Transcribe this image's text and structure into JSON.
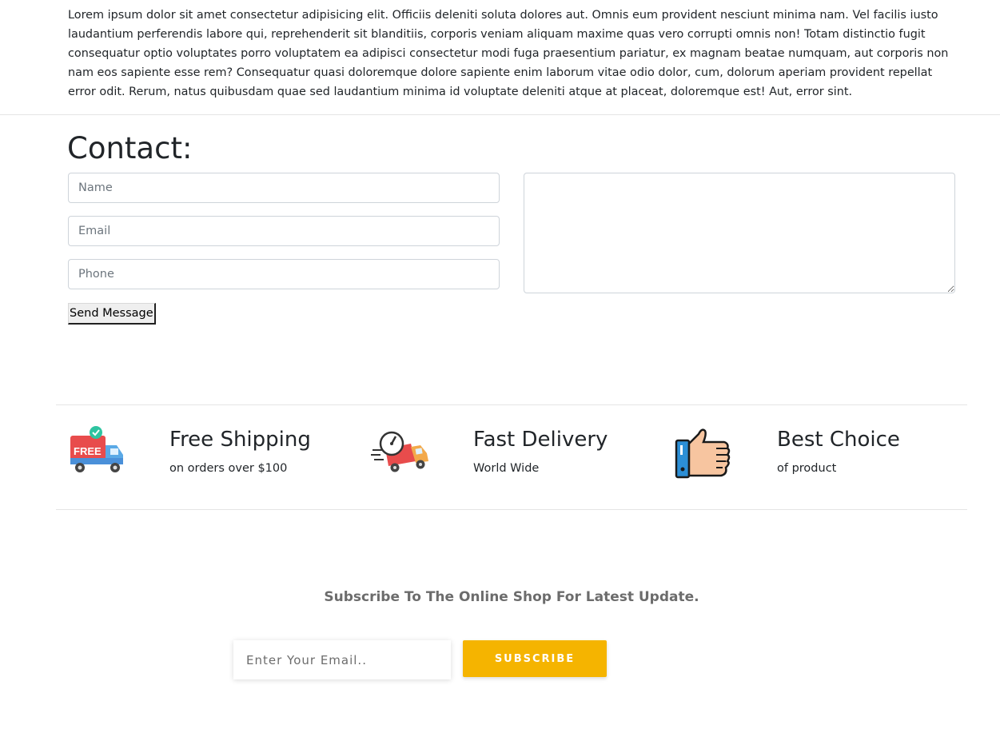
{
  "intro": {
    "text": "Lorem ipsum dolor sit amet consectetur adipisicing elit. Officiis deleniti soluta dolores aut. Omnis eum provident nesciunt minima nam. Vel facilis iusto laudantium perferendis labore qui, reprehenderit sit blanditiis, corporis veniam aliquam maxime quas vero corrupti omnis non! Totam distinctio fugit consequatur optio voluptates porro voluptatem ea adipisci consectetur modi fuga praesentium pariatur, ex magnam beatae numquam, aut corporis non nam eos sapiente esse rem? Consequatur quasi doloremque dolore sapiente enim laborum vitae odio dolor, cum, dolorum aperiam provident repellat error odit. Rerum, natus quibusdam quae sed laudantium minima id voluptate deleniti atque at placeat, doloremque est! Aut, error sint."
  },
  "contact": {
    "title": "Contact:",
    "name_placeholder": "Name",
    "email_placeholder": "Email",
    "phone_placeholder": "Phone",
    "message_value": "",
    "send_label": "Send Message"
  },
  "features": [
    {
      "title": "Free Shipping",
      "subtitle": "on orders over $100",
      "icon": "free-shipping-truck-icon",
      "badge": "FREE"
    },
    {
      "title": "Fast Delivery",
      "subtitle": "World Wide",
      "icon": "fast-delivery-truck-icon"
    },
    {
      "title": "Best Choice",
      "subtitle": "of product",
      "icon": "thumbs-up-icon"
    }
  ],
  "subscribe": {
    "heading": "Subscribe To The Online Shop For Latest Update.",
    "email_placeholder": "Enter Your Email..",
    "button_label": "SUBSCRIBE"
  },
  "colors": {
    "subscribe_button": "#f5b400",
    "text": "#212529",
    "muted": "#6c6c6c"
  }
}
